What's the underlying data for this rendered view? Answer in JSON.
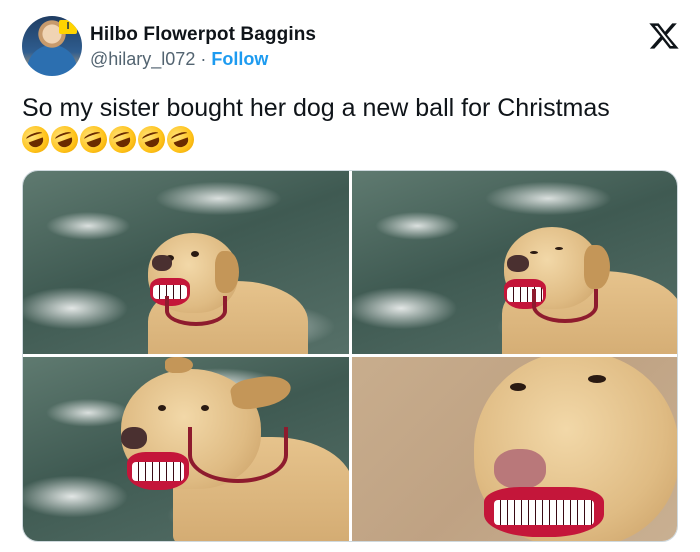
{
  "tweet": {
    "author": {
      "display_name": "Hilbo Flowerpot Baggins",
      "handle": "@hilary_l072",
      "separator": "·",
      "follow_label": "Follow",
      "avatar_badge": "I"
    },
    "text": "So my sister bought her dog a new ball for Christmas",
    "emoji": [
      "rolling-on-floor-laughing",
      "rolling-on-floor-laughing",
      "rolling-on-floor-laughing",
      "rolling-on-floor-laughing",
      "rolling-on-floor-laughing",
      "rolling-on-floor-laughing"
    ],
    "platform_icon": "x-logo-icon",
    "colors": {
      "follow": "#1d9bf0",
      "handle": "#536471",
      "text": "#0f1419",
      "border": "#cfd9de"
    },
    "media": [
      {
        "scene": "sea",
        "subject": "dog-with-teeth-ball"
      },
      {
        "scene": "sea",
        "subject": "dog-with-teeth-ball"
      },
      {
        "scene": "sea",
        "subject": "dog-with-teeth-ball"
      },
      {
        "scene": "sand",
        "subject": "dog-with-teeth-ball-closeup"
      }
    ]
  }
}
